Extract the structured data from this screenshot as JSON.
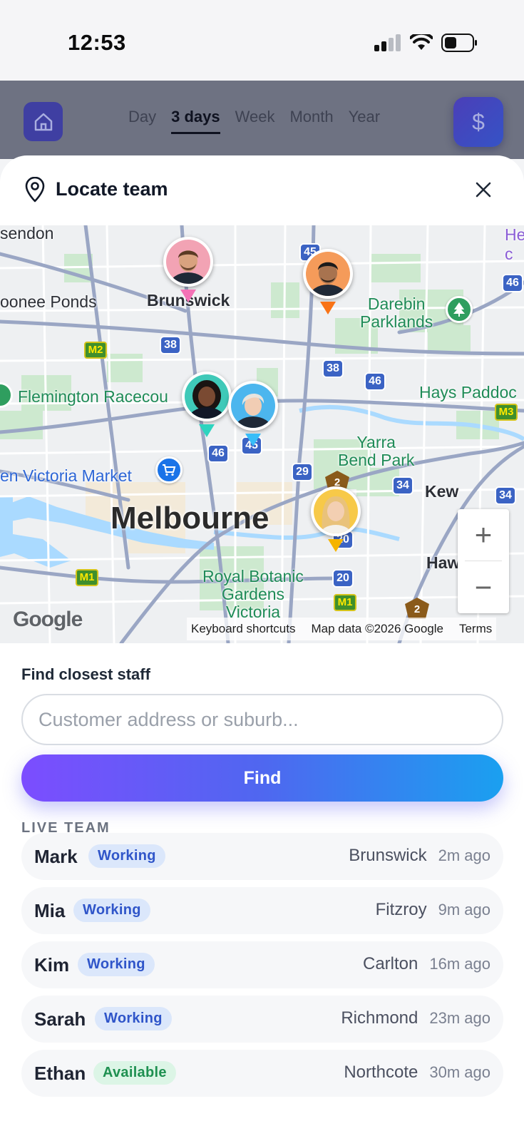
{
  "status_bar": {
    "time": "12:53"
  },
  "header": {
    "tabs": [
      {
        "label": "Day",
        "active": false
      },
      {
        "label": "3 days",
        "active": true
      },
      {
        "label": "Week",
        "active": false
      },
      {
        "label": "Month",
        "active": false
      },
      {
        "label": "Year",
        "active": false
      }
    ],
    "currency_symbol": "$"
  },
  "sheet": {
    "title": "Locate team"
  },
  "map": {
    "labels": {
      "essendon": "sendon",
      "moonee_ponds": "oonee Ponds",
      "brunswick": "Brunswick",
      "darebin": "Darebin\nParklands",
      "heidelberg": "He\nc",
      "flemington": "Flemington Racecou",
      "hays": "Hays Paddoc",
      "yarra": "Yarra\nBend Park",
      "market": "en Victoria Market",
      "kew": "Kew",
      "melbourne": "Melbourne",
      "hawthorn": "Haw",
      "botanic": "Royal Botanic\nGardens\nVictoria"
    },
    "shields": [
      "45",
      "46",
      "38",
      "38",
      "46",
      "46",
      "45",
      "29",
      "34",
      "34",
      "20",
      "20"
    ],
    "m_shields": [
      "M2",
      "M3",
      "M1",
      "M1"
    ],
    "tourist_shields": [
      "2",
      "2"
    ],
    "zoom_in": "+",
    "zoom_out": "−",
    "google_logo": "Google",
    "attribution": {
      "shortcuts": "Keyboard shortcuts",
      "data": "Map data ©2026 Google",
      "terms": "Terms"
    },
    "marker_colors": {
      "mark": "#f472b6",
      "ethan": "#f97316",
      "mia": "#2dd4bf",
      "kim": "#38bdf8",
      "sarah": "#f5b400"
    }
  },
  "find": {
    "label": "Find closest staff",
    "placeholder": "Customer address or suburb...",
    "button": "Find"
  },
  "live_team": {
    "title": "LIVE TEAM",
    "members": [
      {
        "name": "Mark",
        "status": "Working",
        "location": "Brunswick",
        "ago": "2m ago"
      },
      {
        "name": "Mia",
        "status": "Working",
        "location": "Fitzroy",
        "ago": "9m ago"
      },
      {
        "name": "Kim",
        "status": "Working",
        "location": "Carlton",
        "ago": "16m ago"
      },
      {
        "name": "Sarah",
        "status": "Working",
        "location": "Richmond",
        "ago": "23m ago"
      },
      {
        "name": "Ethan",
        "status": "Available",
        "location": "Northcote",
        "ago": "30m ago"
      }
    ]
  }
}
